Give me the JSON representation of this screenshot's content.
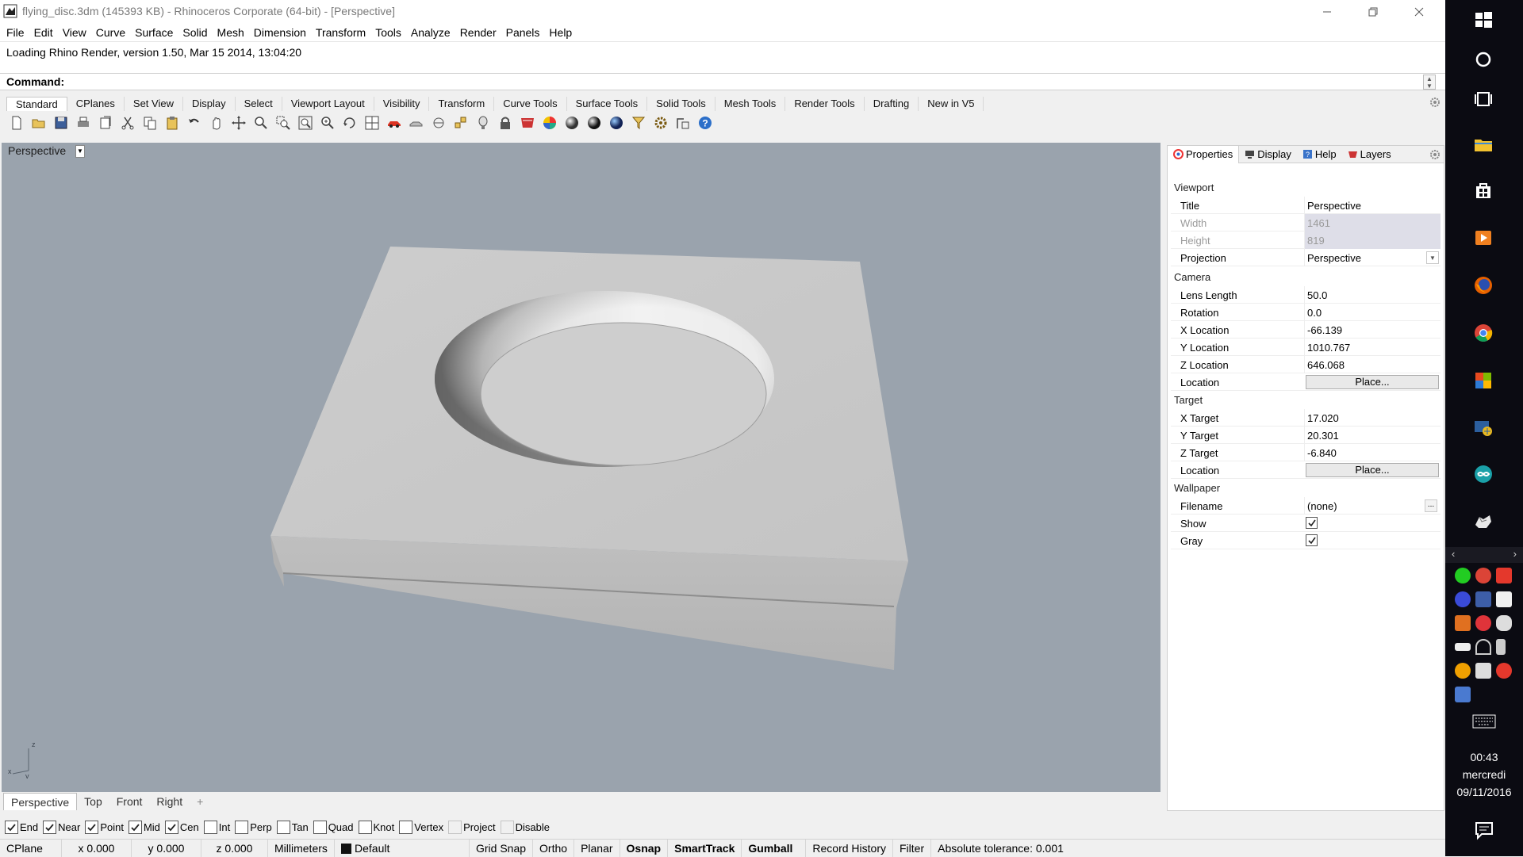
{
  "window": {
    "title": "flying_disc.3dm (145393 KB) - Rhinoceros Corporate (64-bit) - [Perspective]",
    "minimize_icon": "minimize-icon",
    "maximize_icon": "restore-icon",
    "close_icon": "close-icon"
  },
  "menu": [
    "File",
    "Edit",
    "View",
    "Curve",
    "Surface",
    "Solid",
    "Mesh",
    "Dimension",
    "Transform",
    "Tools",
    "Analyze",
    "Render",
    "Panels",
    "Help"
  ],
  "history_line": "Loading Rhino Render, version 1.50, Mar 15 2014, 13:04:20",
  "command": {
    "label": "Command:",
    "value": ""
  },
  "toolbar_tabs": [
    "Standard",
    "CPlanes",
    "Set View",
    "Display",
    "Select",
    "Viewport Layout",
    "Visibility",
    "Transform",
    "Curve Tools",
    "Surface Tools",
    "Solid Tools",
    "Mesh Tools",
    "Render Tools",
    "Drafting",
    "New in V5"
  ],
  "toolbar_icons": [
    "new-icon",
    "open-icon",
    "save-icon",
    "print-icon",
    "import-icon",
    "cut-icon",
    "copy-icon",
    "paste-icon",
    "undo-icon",
    "pan-icon",
    "move-icon",
    "zoom-icon",
    "zoom-window-icon",
    "zoom-extents-icon",
    "zoom-selected-icon",
    "rotate-view-icon",
    "four-views-icon",
    "car-icon",
    "hide-icon",
    "show-icon",
    "points-icon",
    "light-icon",
    "lock-icon",
    "layer-icon",
    "color-wheel-icon",
    "shade-icon",
    "render-sphere-icon",
    "render-icon",
    "filter-icon",
    "options-icon",
    "transform-icon",
    "help-icon"
  ],
  "viewport": {
    "title": "Perspective",
    "axis_x": "x",
    "axis_y": "y",
    "axis_z": "z"
  },
  "viewport_tabs": [
    "Perspective",
    "Top",
    "Front",
    "Right",
    "+"
  ],
  "osnaps": [
    {
      "label": "End",
      "checked": true
    },
    {
      "label": "Near",
      "checked": true
    },
    {
      "label": "Point",
      "checked": true
    },
    {
      "label": "Mid",
      "checked": true
    },
    {
      "label": "Cen",
      "checked": true
    },
    {
      "label": "Int",
      "checked": false
    },
    {
      "label": "Perp",
      "checked": false
    },
    {
      "label": "Tan",
      "checked": false
    },
    {
      "label": "Quad",
      "checked": false
    },
    {
      "label": "Knot",
      "checked": false
    },
    {
      "label": "Vertex",
      "checked": false
    },
    {
      "label": "Project",
      "checked": false,
      "disabled": true
    },
    {
      "label": "Disable",
      "checked": false,
      "disabled": true
    }
  ],
  "statusbar": {
    "cplane": "CPlane",
    "x": "x 0.000",
    "y": "y 0.000",
    "z": "z 0.000",
    "units": "Millimeters",
    "layer": "Default",
    "grid_snap": "Grid Snap",
    "ortho": "Ortho",
    "planar": "Planar",
    "osnap": "Osnap",
    "smarttrack": "SmartTrack",
    "gumball": "Gumball",
    "record_history": "Record History",
    "filter": "Filter",
    "tolerance": "Absolute tolerance: 0.001"
  },
  "panel": {
    "tabs": [
      "Properties",
      "Display",
      "Help",
      "Layers"
    ],
    "viewport_section": "Viewport",
    "title_k": "Title",
    "title_v": "Perspective",
    "width_k": "Width",
    "width_v": "1461",
    "height_k": "Height",
    "height_v": "819",
    "projection_k": "Projection",
    "projection_v": "Perspective",
    "camera_section": "Camera",
    "lens_k": "Lens Length",
    "lens_v": "50.0",
    "rotation_k": "Rotation",
    "rotation_v": "0.0",
    "xloc_k": "X Location",
    "xloc_v": "-66.139",
    "yloc_k": "Y Location",
    "yloc_v": "1010.767",
    "zloc_k": "Z Location",
    "zloc_v": "646.068",
    "cam_location_k": "Location",
    "cam_location_btn": "Place...",
    "target_section": "Target",
    "xtgt_k": "X Target",
    "xtgt_v": "17.020",
    "ytgt_k": "Y Target",
    "ytgt_v": "20.301",
    "ztgt_k": "Z Target",
    "ztgt_v": "-6.840",
    "tgt_location_k": "Location",
    "tgt_location_btn": "Place...",
    "wallpaper_section": "Wallpaper",
    "filename_k": "Filename",
    "filename_v": "(none)",
    "filename_btn": "...",
    "show_k": "Show",
    "show_checked": true,
    "gray_k": "Gray",
    "gray_checked": true
  },
  "taskbar": {
    "buttons": [
      "windows-start-icon",
      "cortana-search-icon",
      "task-view-icon",
      "file-explorer-icon",
      "store-icon",
      "media-player-icon",
      "firefox-icon",
      "chrome-icon",
      "office-icon",
      "network-app-icon",
      "arduino-icon",
      "rhino-icon"
    ],
    "clock_time": "00:43",
    "clock_day": "mercredi",
    "clock_date": "09/11/2016"
  },
  "colors": {
    "viewport_bg": "#9aa3ad",
    "model_face": "#c8c8c8",
    "taskbar_bg": "#0b0b12",
    "active_status": "#000000"
  }
}
